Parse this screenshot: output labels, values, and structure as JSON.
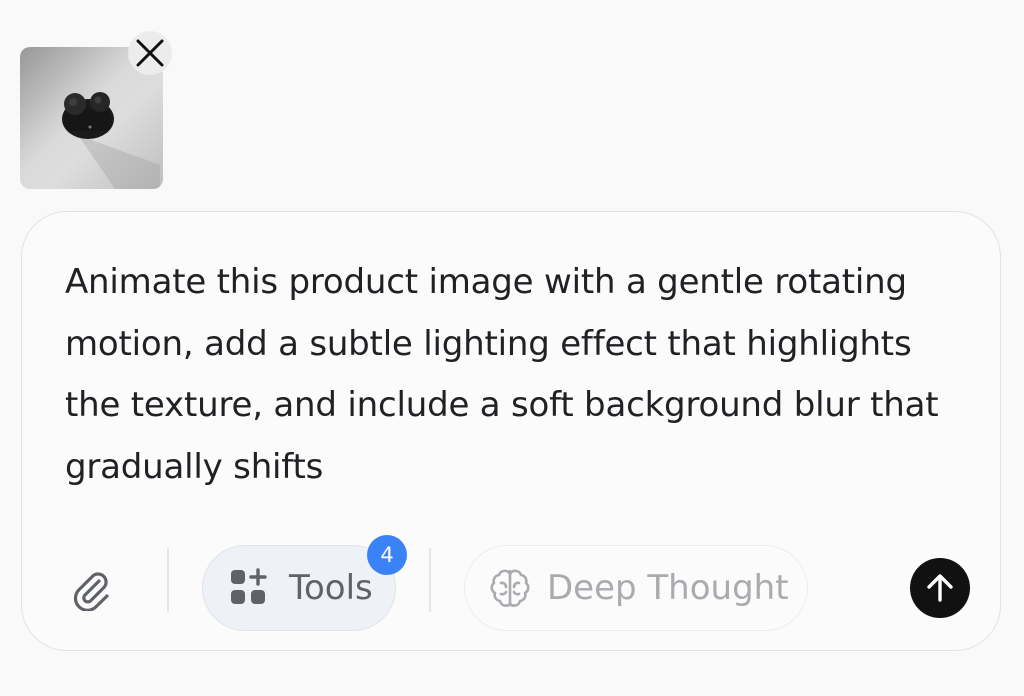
{
  "attachment": {
    "thumbnail": "product-photo-earbuds-case",
    "remove_icon": "close-icon"
  },
  "composer": {
    "prompt_text": "Animate this product image with a gentle rotating motion, add a subtle lighting effect that highlights the texture, and include a soft background blur that gradually shifts",
    "toolbar": {
      "attach_icon": "paperclip-icon",
      "tools": {
        "label": "Tools",
        "icon": "apps-add-icon",
        "badge_count": "4",
        "badge_color": "#3b82f6"
      },
      "deep_thought": {
        "label": "Deep Thought",
        "icon": "brain-icon"
      },
      "send_icon": "arrow-up-icon"
    }
  }
}
